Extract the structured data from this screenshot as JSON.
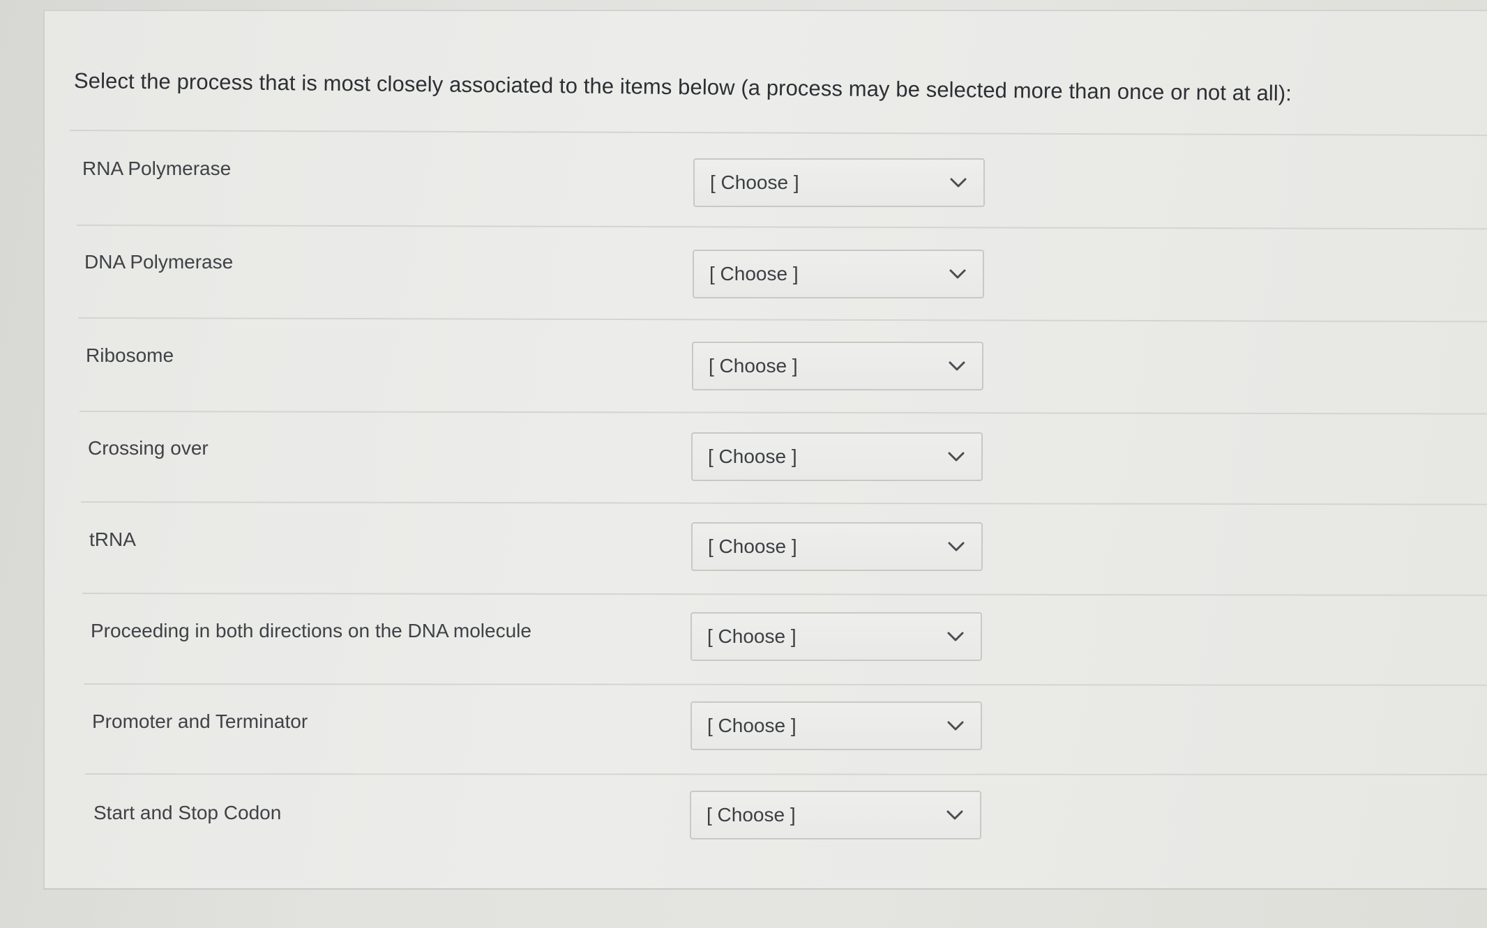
{
  "question": {
    "prompt": "Select the process that is most closely associated to the items below (a process may be selected more than once or not at all):"
  },
  "items": [
    {
      "label": "RNA Polymerase",
      "selected": "[ Choose ]"
    },
    {
      "label": "DNA Polymerase",
      "selected": "[ Choose ]"
    },
    {
      "label": "Ribosome",
      "selected": "[ Choose ]"
    },
    {
      "label": "Crossing over",
      "selected": "[ Choose ]"
    },
    {
      "label": "tRNA",
      "selected": "[ Choose ]"
    },
    {
      "label": "Proceeding in both directions on the DNA molecule",
      "selected": "[ Choose ]"
    },
    {
      "label": "Promoter and Terminator",
      "selected": "[ Choose ]"
    },
    {
      "label": "Start and Stop Codon",
      "selected": "[ Choose ]"
    }
  ],
  "icons": {
    "dropdown": "chevron-down-icon"
  },
  "colors": {
    "text": "#3a3d40",
    "border": "#c8c8c4",
    "background": "#e8e8e5"
  }
}
